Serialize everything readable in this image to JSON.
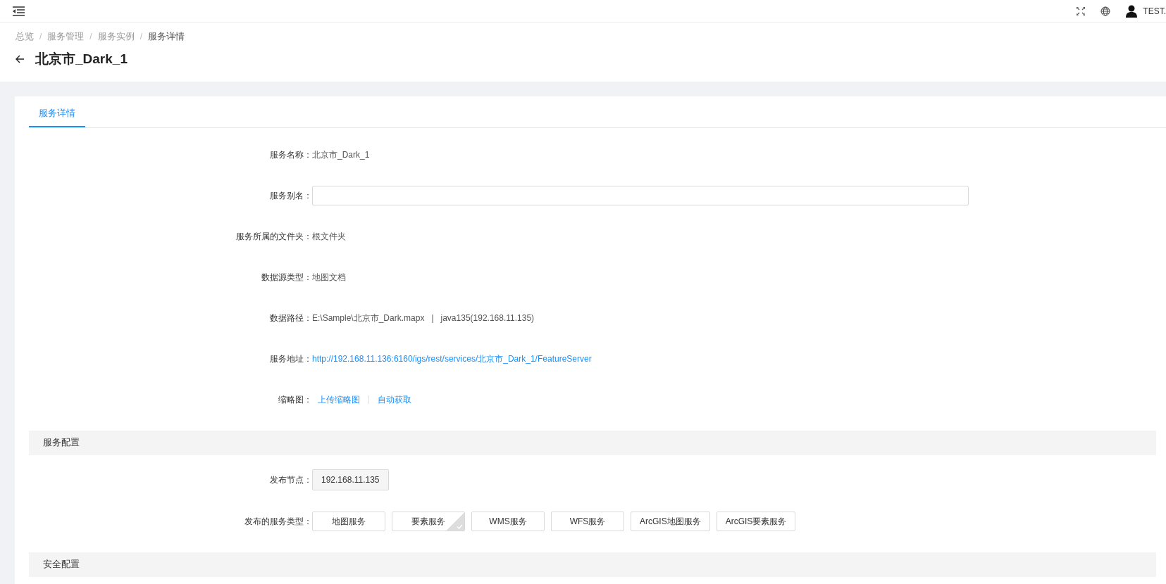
{
  "top_bar": {
    "user": "TEST."
  },
  "breadcrumb": [
    {
      "kind": "link",
      "text": "总览"
    },
    {
      "kind": "separator",
      "text": "/"
    },
    {
      "kind": "link",
      "text": "服务管理"
    },
    {
      "kind": "separator",
      "text": "/"
    },
    {
      "kind": "link",
      "text": "服务实例"
    },
    {
      "kind": "separator",
      "text": "/"
    },
    {
      "kind": "current",
      "text": "服务详情"
    }
  ],
  "title": "北京市_Dark_1",
  "tabs": [
    {
      "label": "服务详情",
      "selected": true
    }
  ],
  "fields": [
    {
      "label": "服务名称：",
      "kind": "text",
      "value": "北京市_Dark_1"
    },
    {
      "label": "服务别名：",
      "kind": "input"
    },
    {
      "label": "服务所属的文件夹：",
      "kind": "text",
      "value": "根文件夹"
    },
    {
      "label": "数据源类型：",
      "kind": "text",
      "value": "地图文档"
    },
    {
      "label": "数据路径：",
      "kind": "path",
      "parts": [
        "E:\\Sample\\北京市_Dark.mapx",
        "|",
        "java135(192.168.11.135)"
      ]
    },
    {
      "label": "服务地址：",
      "kind": "link",
      "value": "http://192.168.11.136:6160/igs/rest/services/北京市_Dark_1/FeatureServer"
    },
    {
      "label": "缩略图：",
      "kind": "links",
      "links": [
        "上传缩略图",
        "自动获取"
      ]
    }
  ],
  "sections": [
    {
      "title": "服务配置",
      "fields": [
        {
          "label": "发布节点：",
          "kind": "tag",
          "value": "192.168.11.135"
        },
        {
          "label": "发布的服务类型：",
          "kind": "options",
          "options": [
            {
              "label": "地图服务",
              "selected": false
            },
            {
              "label": "要素服务",
              "selected": true
            },
            {
              "label": "WMS服务",
              "selected": false
            },
            {
              "label": "WFS服务",
              "selected": false
            },
            {
              "label": "ArcGIS地图服务",
              "selected": false
            },
            {
              "label": "ArcGIS要素服务",
              "selected": false
            }
          ]
        }
      ]
    },
    {
      "title": "安全配置"
    }
  ]
}
